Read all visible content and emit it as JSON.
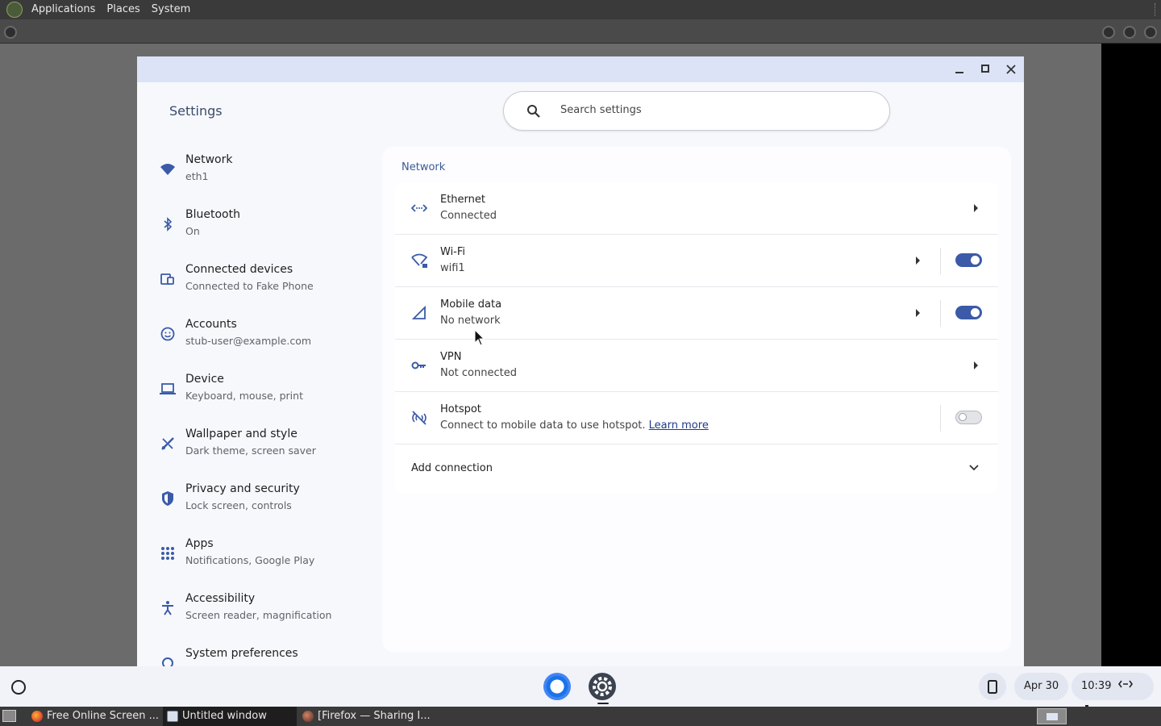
{
  "top_panel": {
    "menus": [
      "Applications",
      "Places",
      "System"
    ]
  },
  "window": {
    "app_title": "Settings",
    "search": {
      "placeholder": "Search settings"
    }
  },
  "sidebar": {
    "items": [
      {
        "title": "Network",
        "subtitle": "eth1",
        "icon": "wifi-icon"
      },
      {
        "title": "Bluetooth",
        "subtitle": "On",
        "icon": "bluetooth-icon"
      },
      {
        "title": "Connected devices",
        "subtitle": "Connected to Fake Phone",
        "icon": "connected-devices-icon"
      },
      {
        "title": "Accounts",
        "subtitle": "stub-user@example.com",
        "icon": "accounts-icon"
      },
      {
        "title": "Device",
        "subtitle": "Keyboard, mouse, print",
        "icon": "laptop-icon"
      },
      {
        "title": "Wallpaper and style",
        "subtitle": "Dark theme, screen saver",
        "icon": "paint-brush-icon"
      },
      {
        "title": "Privacy and security",
        "subtitle": "Lock screen, controls",
        "icon": "shield-icon"
      },
      {
        "title": "Apps",
        "subtitle": "Notifications, Google Play",
        "icon": "apps-grid-icon"
      },
      {
        "title": "Accessibility",
        "subtitle": "Screen reader, magnification",
        "icon": "accessibility-icon"
      },
      {
        "title": "System preferences",
        "subtitle": "",
        "icon": "system-icon"
      }
    ]
  },
  "network": {
    "title": "Network",
    "rows": [
      {
        "title": "Ethernet",
        "subtitle": "Connected",
        "icon": "ethernet-icon"
      },
      {
        "title": "Wi-Fi",
        "subtitle": "wifi1",
        "icon": "wifi-lock-icon",
        "enabled": true
      },
      {
        "title": "Mobile data",
        "subtitle": "No network",
        "icon": "cellular-icon",
        "enabled": true
      },
      {
        "title": "VPN",
        "subtitle": "Not connected",
        "icon": "vpn-key-icon"
      },
      {
        "title": "Hotspot",
        "subtitle": "Connect to mobile data to use hotspot.",
        "link": "Learn more",
        "icon": "hotspot-off-icon",
        "enabled": false
      }
    ],
    "add_connection": "Add connection"
  },
  "shelf": {
    "date": "Apr 30",
    "time": "10:39"
  },
  "taskbar": {
    "tasks": [
      {
        "label": "Free Online Screen ..."
      },
      {
        "label": "Untitled window"
      },
      {
        "label": "[Firefox — Sharing I..."
      }
    ]
  },
  "colors": {
    "accent": "#3b5aa8",
    "titlebar": "#dce3f7",
    "window_bg": "#f6f8fc"
  }
}
